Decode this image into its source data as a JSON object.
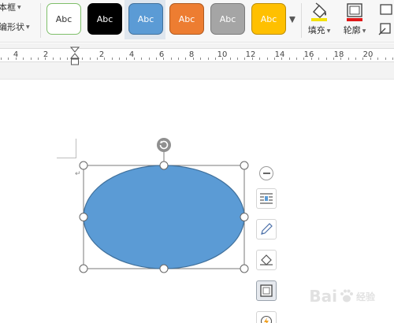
{
  "toolbar": {
    "left_tools": [
      {
        "label": "本框",
        "has_dropdown": true
      },
      {
        "label": "编形状",
        "has_dropdown": true
      }
    ],
    "shape_styles": [
      {
        "label": "Abc",
        "fill": "#ffffff",
        "border": "#7fbf6a",
        "text_color": "#333333"
      },
      {
        "label": "Abc",
        "fill": "#000000",
        "border": "#000000",
        "text_color": "#ffffff"
      },
      {
        "label": "Abc",
        "fill": "#5b9bd5",
        "border": "#41719c",
        "text_color": "#ffffff",
        "selected": true
      },
      {
        "label": "Abc",
        "fill": "#ed7d31",
        "border": "#ae5a21",
        "text_color": "#ffffff"
      },
      {
        "label": "Abc",
        "fill": "#a5a5a5",
        "border": "#7a7a7a",
        "text_color": "#ffffff"
      },
      {
        "label": "Abc",
        "fill": "#ffc000",
        "border": "#bc8c00",
        "text_color": "#ffffff"
      }
    ],
    "fill_label": "填充",
    "outline_label": "轮廓",
    "fill_icon": "paint-bucket-icon",
    "outline_icon": "shape-outline-icon",
    "effects_icon": "shape-effects-icon"
  },
  "ruler": {
    "labels": [
      "4",
      "2",
      "2",
      "4",
      "6",
      "8",
      "10",
      "12",
      "14",
      "16",
      "18",
      "20"
    ]
  },
  "shape": {
    "type": "ellipse",
    "fill": "#5b9bd5",
    "stroke": "#41719c",
    "rotate_icon": "rotate-handle-icon"
  },
  "side_tools": [
    {
      "name": "wrap-text-icon"
    },
    {
      "name": "pen-icon"
    },
    {
      "name": "fill-bucket-icon"
    },
    {
      "name": "outline-frame-icon",
      "active": true
    },
    {
      "name": "effects-icon"
    }
  ],
  "watermark": {
    "text": "Bai",
    "suffix": "经验"
  }
}
